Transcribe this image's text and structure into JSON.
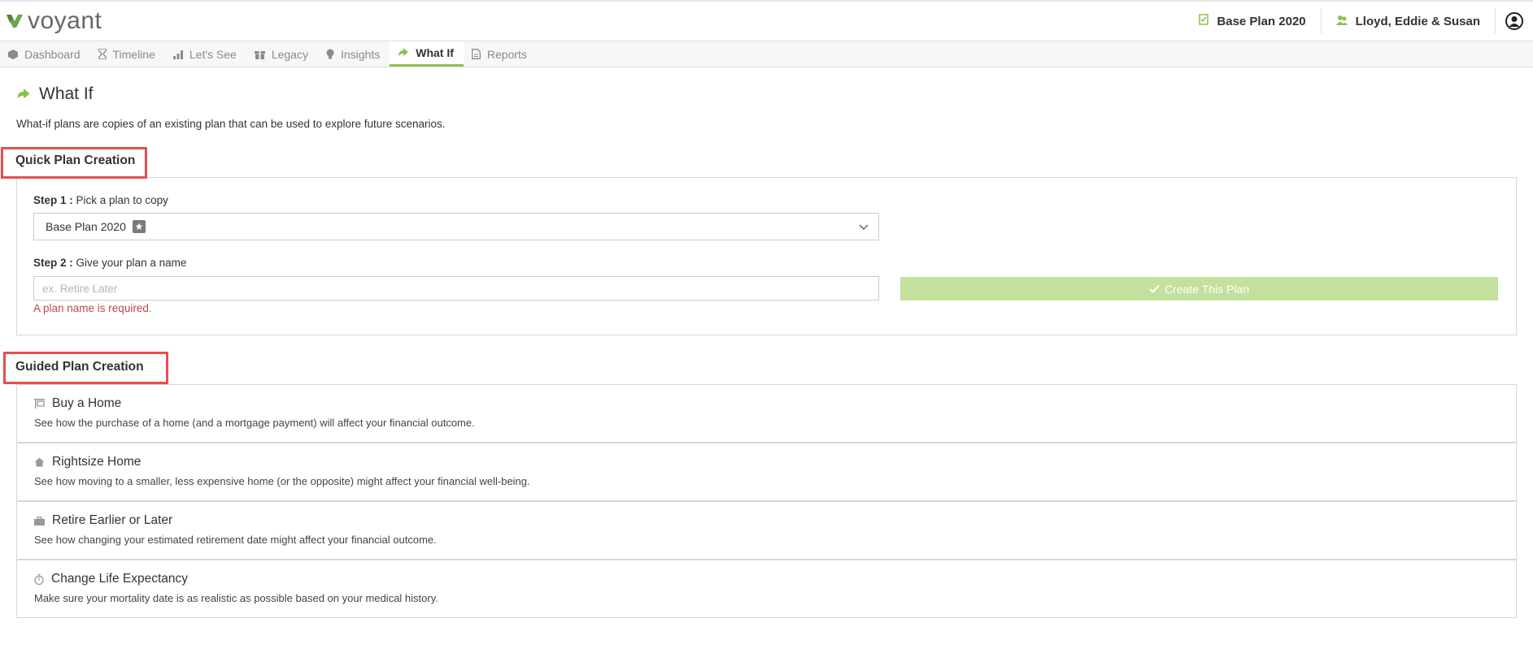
{
  "header": {
    "logo_text": "voyant",
    "plan_label": "Base Plan 2020",
    "clients_label": "Lloyd, Eddie & Susan"
  },
  "tabs": [
    {
      "label": "Dashboard",
      "icon": "cube-icon"
    },
    {
      "label": "Timeline",
      "icon": "hourglass-icon"
    },
    {
      "label": "Let's See",
      "icon": "bar-chart-icon"
    },
    {
      "label": "Legacy",
      "icon": "gift-icon"
    },
    {
      "label": "Insights",
      "icon": "lightbulb-icon"
    },
    {
      "label": "What If",
      "icon": "what-if-icon",
      "active": true
    },
    {
      "label": "Reports",
      "icon": "document-icon"
    }
  ],
  "page": {
    "title": "What If",
    "intro": "What-if plans are copies of an existing plan that can be used to explore future scenarios."
  },
  "quick": {
    "title": "Quick Plan Creation",
    "step1_bold": "Step 1 :",
    "step1_text": "Pick a plan to copy",
    "selected_plan": "Base Plan 2020",
    "step2_bold": "Step 2 :",
    "step2_text": "Give your plan a name",
    "name_placeholder": "ex. Retire Later",
    "name_value": "",
    "error": "A plan name is required.",
    "create_label": "Create This Plan"
  },
  "guided": {
    "title": "Guided Plan Creation",
    "items": [
      {
        "title": "Buy a Home",
        "desc": "See how the purchase of a home (and a mortgage payment) will affect your financial outcome.",
        "icon": "sign-icon"
      },
      {
        "title": "Rightsize Home",
        "desc": "See how moving to a smaller, less expensive home (or the opposite) might affect your financial well-being.",
        "icon": "house-icon"
      },
      {
        "title": "Retire Earlier or Later",
        "desc": "See how changing your estimated retirement date might affect your financial outcome.",
        "icon": "briefcase-icon"
      },
      {
        "title": "Change Life Expectancy",
        "desc": "Make sure your mortality date is as realistic as possible based on your medical history.",
        "icon": "stopwatch-icon"
      }
    ]
  },
  "colors": {
    "accent": "#8cc152",
    "button_disabled": "#c3e09c",
    "error": "#b94a48",
    "highlight": "#e84e4e"
  }
}
